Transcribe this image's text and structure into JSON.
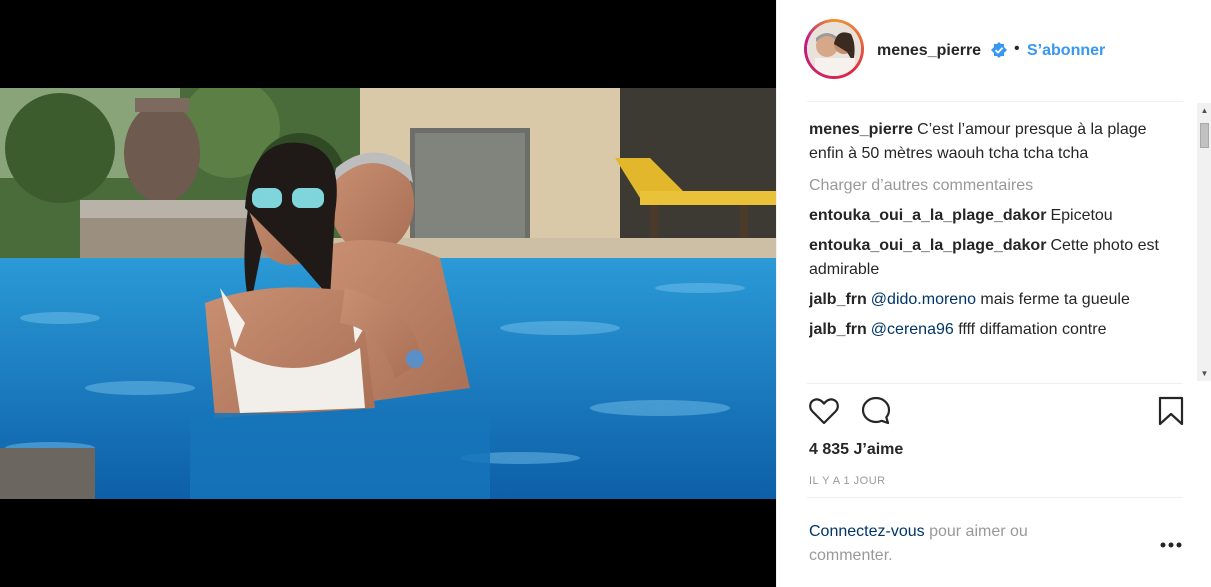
{
  "post": {
    "username": "menes_pierre",
    "follow_label": "S’abonner",
    "separator": "•"
  },
  "caption": {
    "username": "menes_pierre",
    "text": "C’est l’amour presque à la plage enfin à 50 mètres waouh tcha tcha tcha"
  },
  "load_more_label": "Charger d’autres commentaires",
  "comments": [
    {
      "username": "entouka_oui_a_la_plage_dakor",
      "text": "Epicetou"
    },
    {
      "username": "entouka_oui_a_la_plage_dakor",
      "text": "Cette photo est admirable"
    },
    {
      "username": "jalb_frn",
      "mention": "@dido.moreno",
      "text": " mais ferme ta gueule"
    },
    {
      "username": "jalb_frn",
      "mention": "@cerena96",
      "text": " ffff diffamation contre"
    }
  ],
  "likes_label": "4 835 J’aime",
  "time_label": "IL Y A 1 JOUR",
  "login": {
    "link_label": "Connectez-vous",
    "suffix": " pour aimer ou commenter."
  },
  "icons": {
    "like": "heart-icon",
    "comment": "comment-icon",
    "save": "bookmark-icon",
    "verified": "verified-badge-icon",
    "more": "more-options-icon"
  },
  "colors": {
    "link_blue": "#3897f0",
    "mention_blue": "#003569",
    "muted": "#999999",
    "pool": "#1a86c9"
  }
}
